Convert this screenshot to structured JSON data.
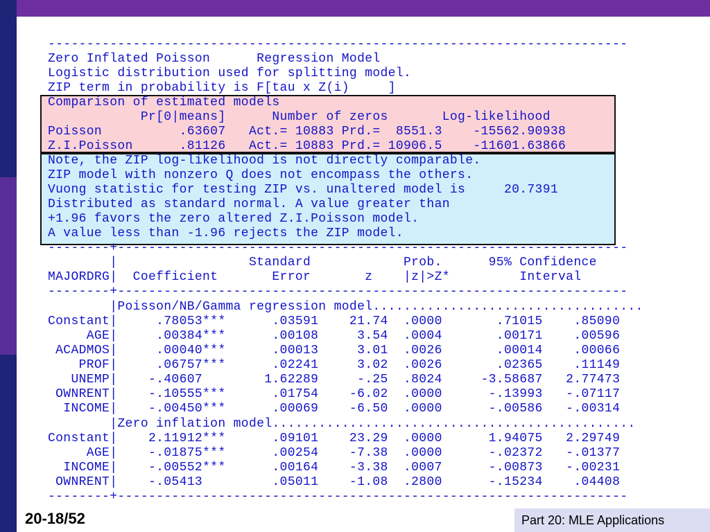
{
  "header_lines": [
    "---------------------------------------------------------------------------",
    "Zero Inflated Poisson      Regression Model",
    "Logistic distribution used for splitting model.",
    "ZIP term in probability is F[tau x Z(i)     ]"
  ],
  "comparison_lines": [
    "Comparison of estimated models",
    "            Pr[0|means]      Number of zeros       Log-likelihood",
    "Poisson          .63607   Act.= 10883 Prd.=  8551.3    -15562.90938",
    "Z.I.Poisson      .81126   Act.= 10883 Prd.= 10906.5    -11601.63866"
  ],
  "note_lines": [
    "Note, the ZIP log-likelihood is not directly comparable.",
    "ZIP model with nonzero Q does not encompass the others.",
    "Vuong statistic for testing ZIP vs. unaltered model is     20.7391",
    "Distributed as standard normal. A value greater than",
    "+1.96 favors the zero altered Z.I.Poisson model.",
    "A value less than -1.96 rejects the ZIP model."
  ],
  "table_header_lines": [
    "--------+------------------------------------------------------------------",
    "        |                 Standard            Prob.      95% Confidence",
    "MAJORDRG|  Coefficient       Error       z    |z|>Z*         Interval",
    "--------+------------------------------------------------------------------"
  ],
  "table_body_lines": [
    "        |Poisson/NB/Gamma regression model...................................",
    "Constant|     .78053***      .03591    21.74  .0000       .71015    .85090",
    "     AGE|     .00384***      .00108     3.54  .0004       .00171    .00596",
    " ACADMOS|     .00040***      .00013     3.01  .0026       .00014    .00066",
    "    PROF|     .06757***      .02241     3.02  .0026       .02365    .11149",
    "   UNEMP|    -.40607        1.62289     -.25  .8024     -3.58687   2.77473",
    " OWNRENT|    -.10555***      .01754    -6.02  .0000      -.13993   -.07117",
    "  INCOME|    -.00450***      .00069    -6.50  .0000      -.00586   -.00314",
    "        |Zero inflation model...............................................",
    "Constant|    2.11912***      .09101    23.29  .0000      1.94075   2.29749",
    "     AGE|    -.01875***      .00254    -7.38  .0000      -.02372   -.01377",
    "  INCOME|    -.00552***      .00164    -3.38  .0007      -.00873   -.00231",
    " OWNRENT|    -.05413         .05011    -1.08  .2800      -.15234    .04408",
    "--------+------------------------------------------------------------------"
  ],
  "footer": {
    "slide_number": "20-18/52",
    "part_label": "Part 20: MLE Applications"
  },
  "colors": {
    "top_bar": "#6e2f9e",
    "left_bar": "#22267a",
    "text": "#1414c8",
    "comparison_box": "#fbd3d6",
    "note_box": "#cfeffb",
    "footer_box": "#dcdcf2"
  }
}
